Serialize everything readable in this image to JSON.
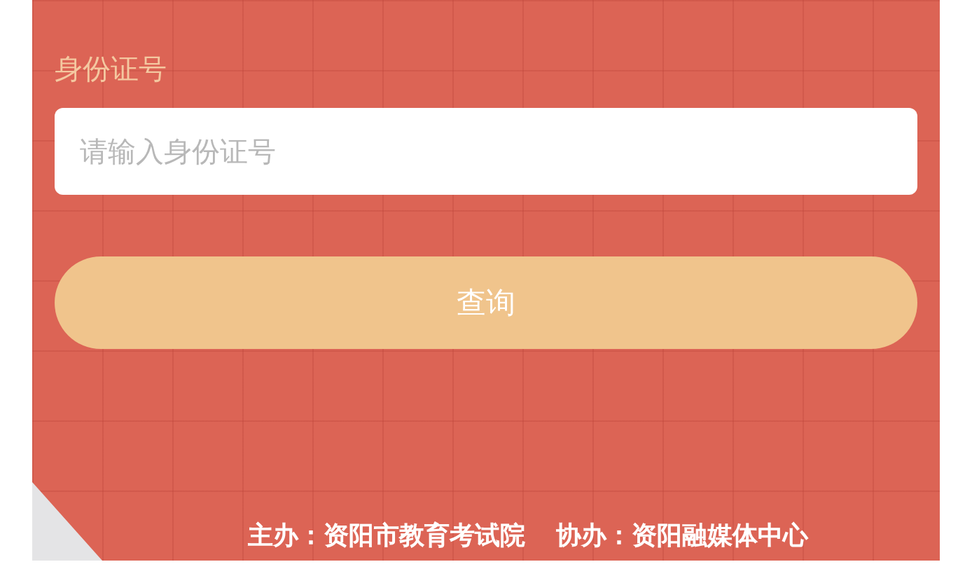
{
  "form": {
    "label": "身份证号",
    "placeholder": "请输入身份证号",
    "button": "查询"
  },
  "footer": [
    "主办：资阳市教育考试院",
    "协办：资阳融媒体中心"
  ]
}
